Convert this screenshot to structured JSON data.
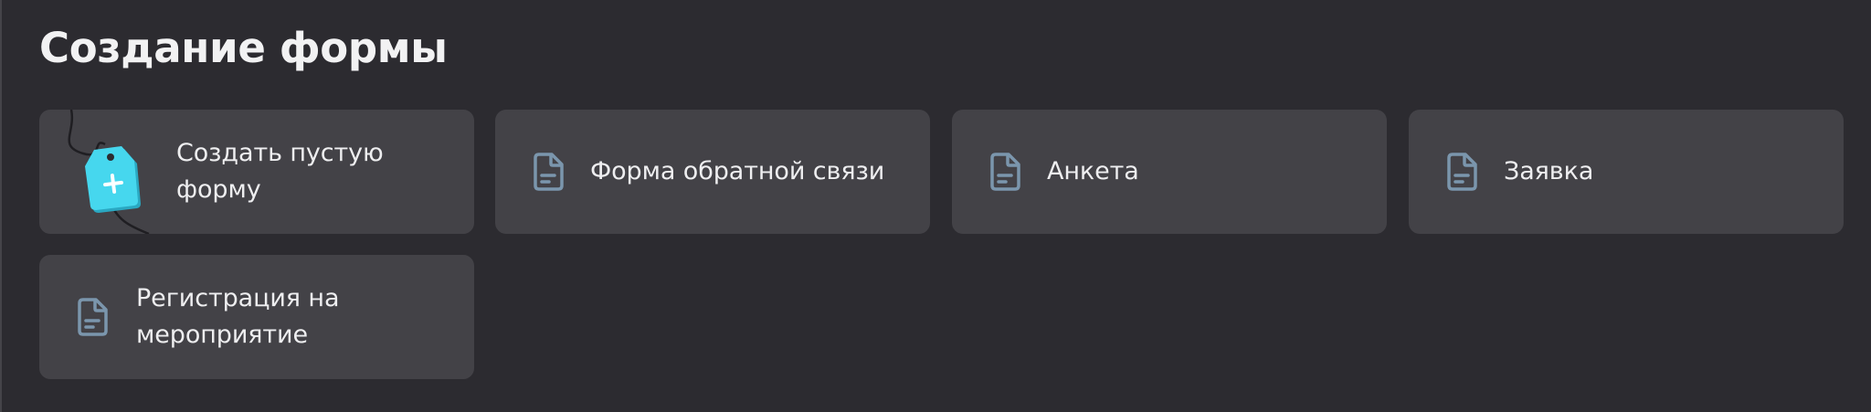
{
  "page": {
    "title": "Создание формы"
  },
  "cards": [
    {
      "label": "Создать пустую форму",
      "icon": "new-form-tag-icon"
    },
    {
      "label": "Форма обратной связи",
      "icon": "document-icon"
    },
    {
      "label": "Анкета",
      "icon": "document-icon"
    },
    {
      "label": "Заявка",
      "icon": "document-icon"
    },
    {
      "label": "Регистрация на мероприятие",
      "icon": "document-icon"
    }
  ],
  "colors": {
    "background": "#2c2b30",
    "card": "#434247",
    "text": "#eeeef0",
    "doc_icon": "#7b96ad",
    "tag_accent": "#3fd3ec"
  }
}
